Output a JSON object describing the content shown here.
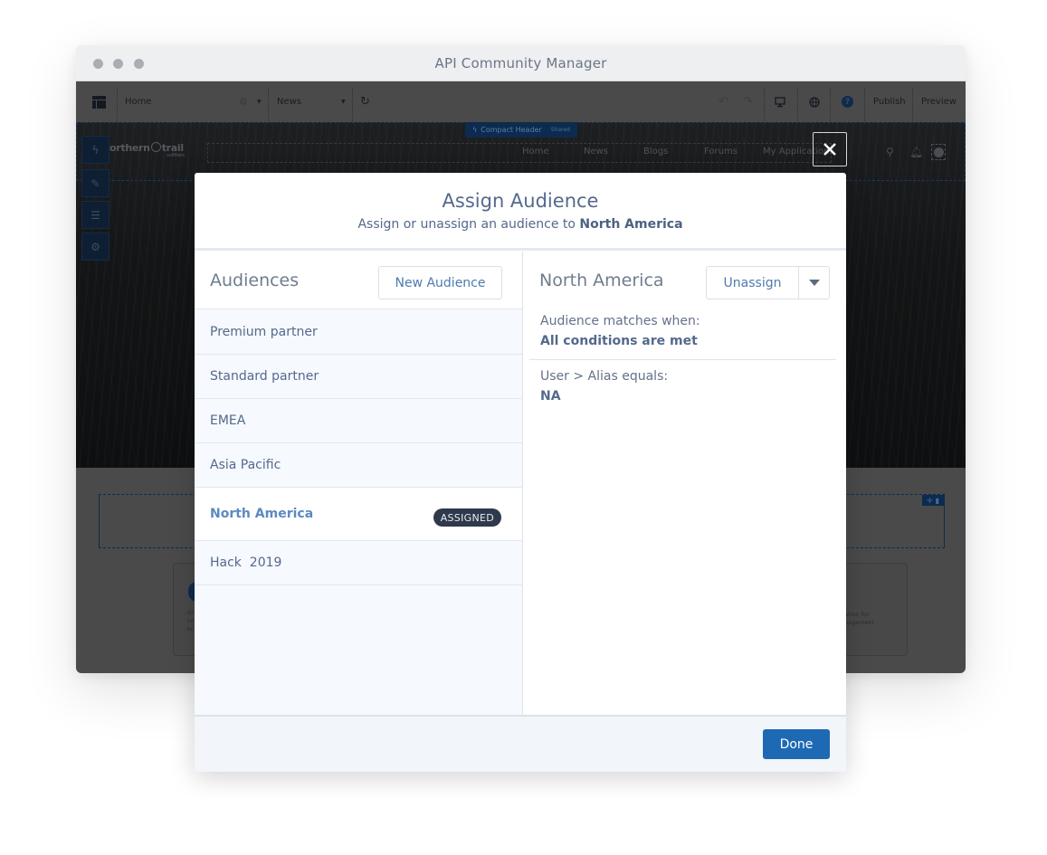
{
  "window": {
    "title": "API Community Manager"
  },
  "toolbar": {
    "page_selector": "Home",
    "audience_selector": "News",
    "publish_label": "Publish",
    "preview_label": "Preview"
  },
  "site_preview": {
    "compact_header_label": "Compact Header",
    "compact_header_tag": "Shared",
    "logo_text": "orthern",
    "logo_text_2": "trail",
    "logo_subtext": "outfitters",
    "nav_items": [
      "Home",
      "News",
      "Blogs",
      "Forums",
      "My Applications"
    ],
    "card_text_left": [
      "Gr",
      "co",
      "ec"
    ],
    "card_text_right": [
      "nation for",
      "anagement"
    ]
  },
  "modal": {
    "title": "Assign Audience",
    "subtitle_prefix": "Assign or unassign an audience to ",
    "subtitle_target": "North America",
    "left_pane": {
      "title": "Audiences",
      "new_button": "New Audience",
      "items": [
        {
          "label": "Premium partner",
          "assigned": false
        },
        {
          "label": "Standard partner",
          "assigned": false
        },
        {
          "label": "EMEA",
          "assigned": false
        },
        {
          "label": "Asia Pacific",
          "assigned": false
        },
        {
          "label": "North America",
          "assigned": true,
          "selected": true
        },
        {
          "label": "Hack  2019",
          "assigned": false
        }
      ],
      "assigned_badge": "ASSIGNED"
    },
    "right_pane": {
      "title": "North America",
      "unassign_button": "Unassign",
      "match_label": "Audience matches when:",
      "match_value": "All conditions are met",
      "criteria_label": "User > Alias equals:",
      "criteria_value": "NA"
    },
    "done_button": "Done"
  },
  "colors": {
    "accent": "#1e69b4",
    "link": "#4e7ab0",
    "text": "#54698d",
    "badge": "#2e3a4b"
  }
}
